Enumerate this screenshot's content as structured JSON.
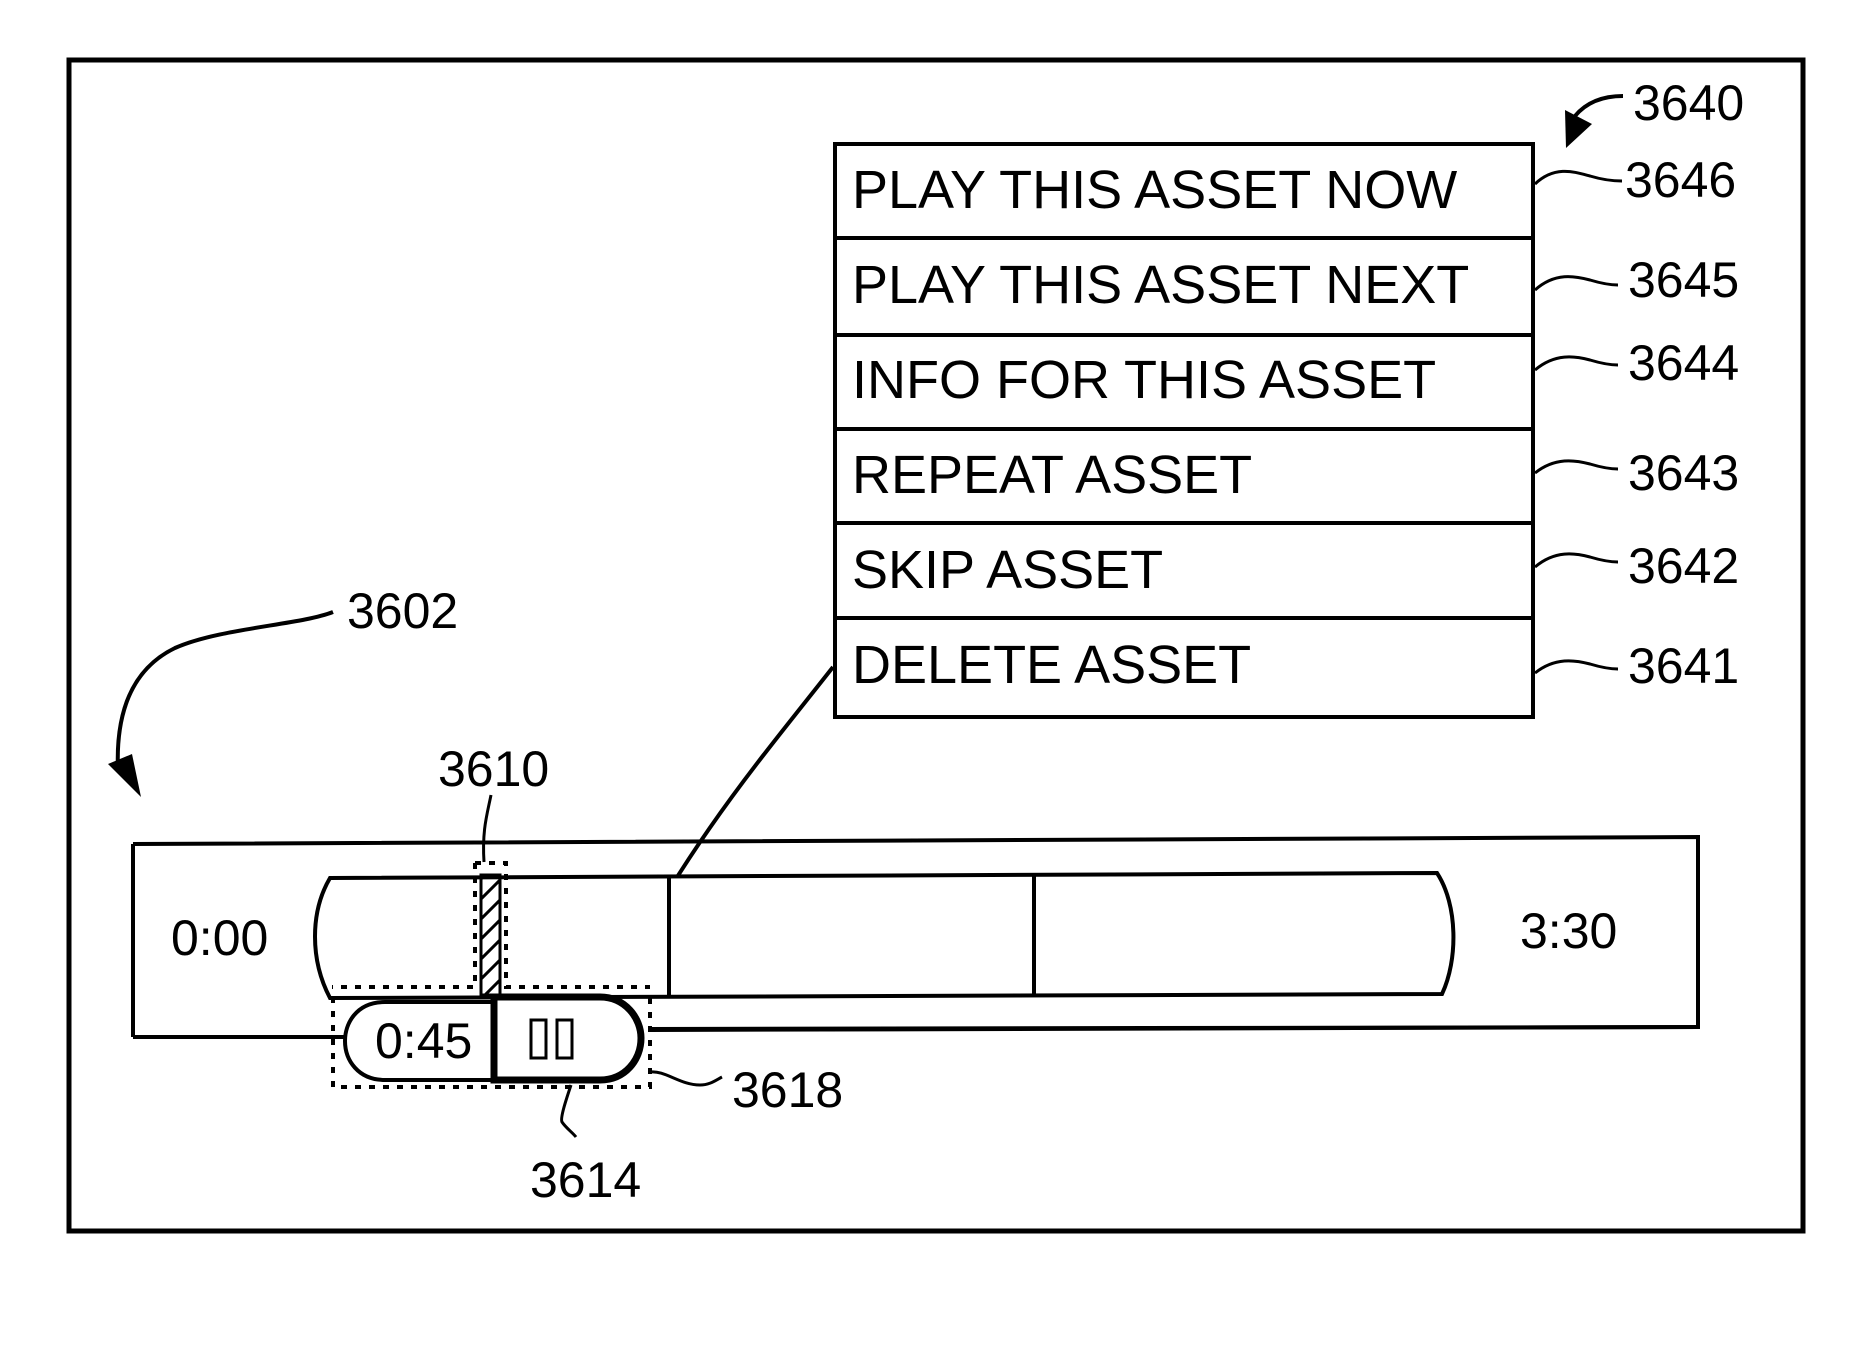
{
  "figure": {
    "reference_labels": {
      "menu": "3640",
      "timeline": "3602",
      "position_marker": "3610",
      "pause_button": "3614",
      "scrubber_group": "3618"
    }
  },
  "context_menu": {
    "items": [
      {
        "label": "PLAY THIS ASSET NOW",
        "ref": "3646"
      },
      {
        "label": "PLAY THIS ASSET NEXT",
        "ref": "3645"
      },
      {
        "label": "INFO FOR THIS ASSET",
        "ref": "3644"
      },
      {
        "label": "REPEAT ASSET",
        "ref": "3643"
      },
      {
        "label": "SKIP ASSET",
        "ref": "3642"
      },
      {
        "label": "DELETE ASSET",
        "ref": "3641"
      }
    ]
  },
  "timeline": {
    "start_time": "0:00",
    "end_time": "3:30",
    "current_time": "0:45",
    "segment_count": 3,
    "play_state_icon": "pause-icon"
  }
}
